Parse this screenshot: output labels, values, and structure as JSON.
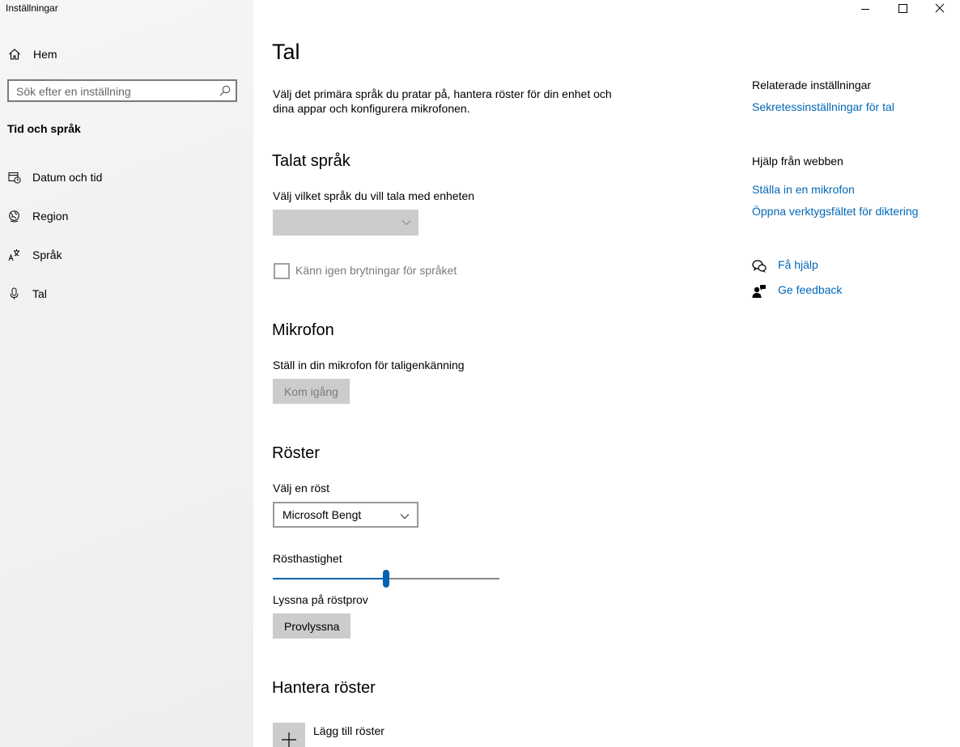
{
  "window": {
    "title": "Inställningar",
    "controls": [
      "minimize-icon",
      "maximize-icon",
      "close-icon"
    ]
  },
  "sidebar": {
    "home_label": "Hem",
    "search_placeholder": "Sök efter en inställning",
    "section_title": "Tid och språk",
    "items": [
      {
        "label": "Datum och tid",
        "icon": "calendar-clock-icon"
      },
      {
        "label": "Region",
        "icon": "globe-icon"
      },
      {
        "label": "Språk",
        "icon": "language-icon"
      },
      {
        "label": "Tal",
        "icon": "microphone-icon"
      }
    ]
  },
  "main": {
    "title": "Tal",
    "description": "Välj det primära språk du pratar på, hantera röster för din enhet och dina appar och konfigurera mikrofonen.",
    "spoken_language": {
      "heading": "Talat språk",
      "label": "Välj vilket språk du vill tala med enheten",
      "dropdown_value": "",
      "checkbox_label": "Känn igen brytningar för språket",
      "checkbox_checked": false
    },
    "microphone": {
      "heading": "Mikrofon",
      "label": "Ställ in din mikrofon för taligenkänning",
      "button_label": "Kom igång"
    },
    "voices": {
      "heading": "Röster",
      "choose_label": "Välj en röst",
      "voice_value": "Microsoft Bengt",
      "speed_label": "Rösthastighet",
      "speed_fraction": 0.5,
      "preview_label": "Lyssna på röstprov",
      "preview_button": "Provlyssna"
    },
    "manage_voices": {
      "heading": "Hantera röster",
      "add_label": "Lägg till röster"
    }
  },
  "right": {
    "related_heading": "Relaterade inställningar",
    "related_link": "Sekretessinställningar för tal",
    "web_help_heading": "Hjälp från webben",
    "web_links": [
      "Ställa in en mikrofon",
      "Öppna verktygsfältet för diktering"
    ],
    "get_help": "Få hjälp",
    "feedback": "Ge feedback"
  },
  "colors": {
    "accent": "#0063b1",
    "link": "#0067b8",
    "disabled_fill": "#cccccc"
  }
}
